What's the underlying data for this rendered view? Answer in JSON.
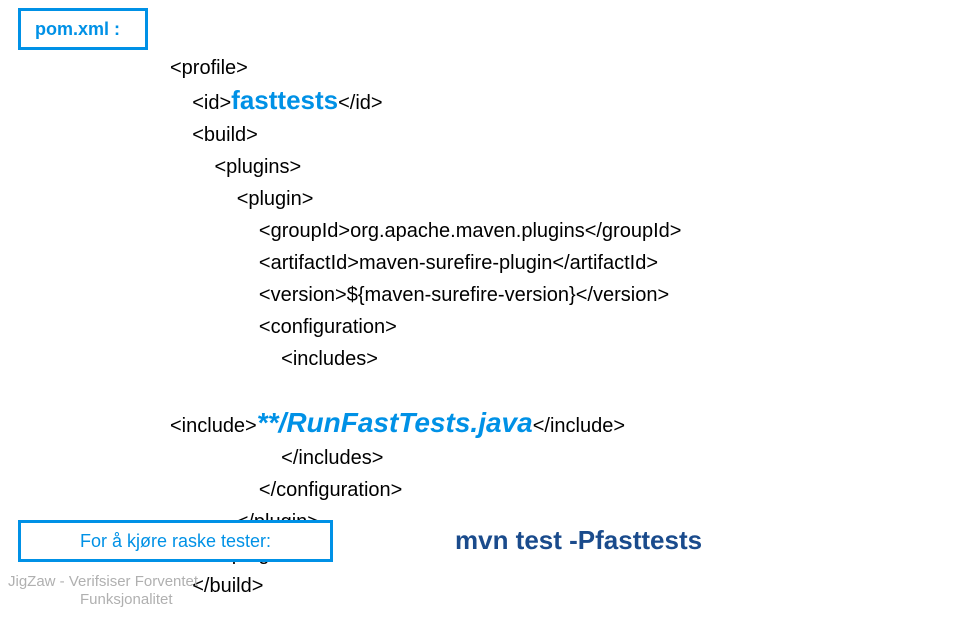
{
  "labels": {
    "top": "pom.xml :",
    "bottom": "For å kjøre raske tester:"
  },
  "code": {
    "l1": "<profile>",
    "l2a": "<id>",
    "l2b": "fasttests",
    "l2c": "</id>",
    "l3": "<build>",
    "l4": "<plugins>",
    "l5": "<plugin>",
    "l6": "<groupId>org.apache.maven.plugins</groupId>",
    "l7": "<artifactId>maven-surefire-plugin</artifactId>",
    "l8": "<version>${maven-surefire-version}</version>",
    "l9": "<configuration>",
    "l10": "<includes>",
    "l11a": "<include>",
    "l11b": "**/RunFastTests.java",
    "l11c": "</include>",
    "l12": "</includes>",
    "l13": "</configuration>",
    "l14": "</plugin>",
    "l15": "</plugins>",
    "l16": "</build>"
  },
  "mvn": "mvn test -Pfasttests",
  "footer": {
    "l1": "JigZaw - Verifsiser Forventet",
    "l2": "Funksjonalitet"
  }
}
